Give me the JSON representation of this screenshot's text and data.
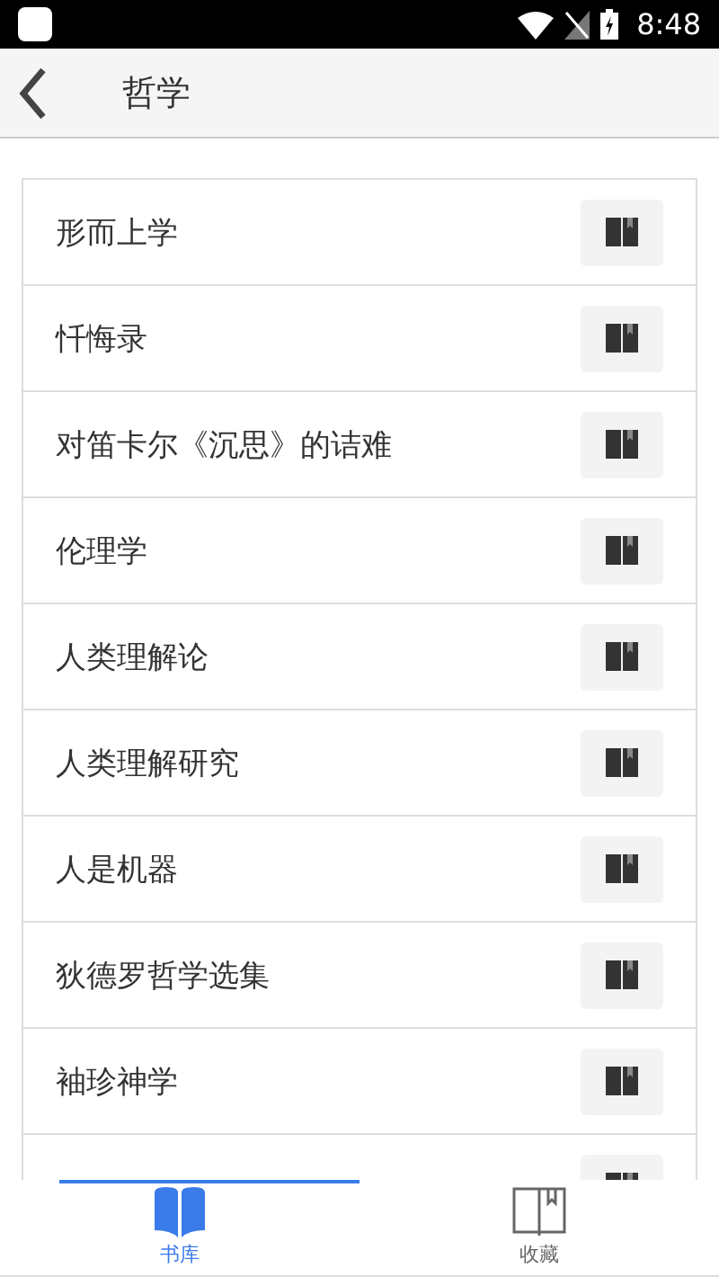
{
  "status_bar": {
    "time": "8:48"
  },
  "header": {
    "title": "哲学"
  },
  "books": [
    {
      "title": "形而上学"
    },
    {
      "title": "忏悔录"
    },
    {
      "title": "对笛卡尔《沉思》的诘难"
    },
    {
      "title": "伦理学"
    },
    {
      "title": "人类理解论"
    },
    {
      "title": "人类理解研究"
    },
    {
      "title": "人是机器"
    },
    {
      "title": "狄德罗哲学选集"
    },
    {
      "title": "袖珍神学"
    },
    {
      "partial": true
    }
  ],
  "tabs": [
    {
      "label": "书库",
      "kind": "library",
      "selected": true
    },
    {
      "label": "收藏",
      "kind": "favorites",
      "selected": false
    }
  ]
}
